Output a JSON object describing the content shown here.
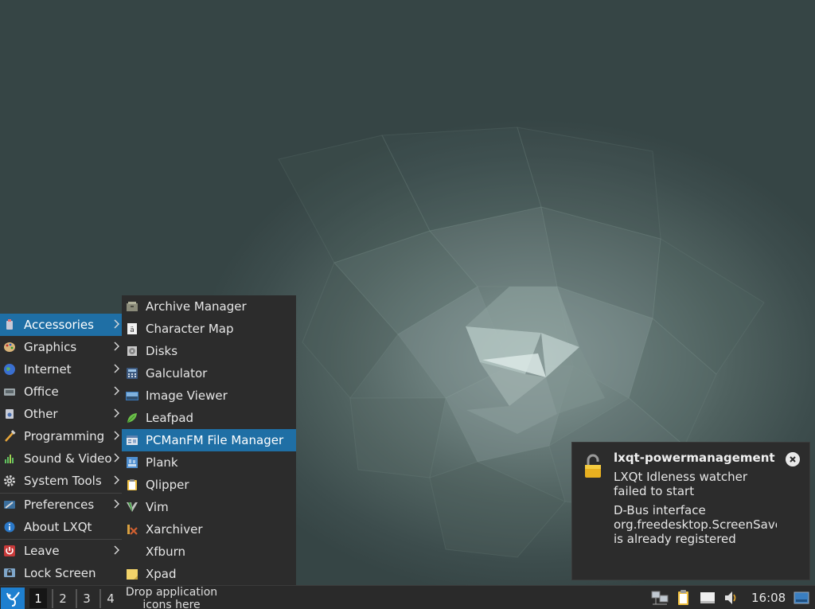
{
  "main_menu": {
    "items": [
      {
        "label": "Accessories",
        "icon": "accessories-icon"
      },
      {
        "label": "Graphics",
        "icon": "graphics-icon"
      },
      {
        "label": "Internet",
        "icon": "internet-icon"
      },
      {
        "label": "Office",
        "icon": "office-icon"
      },
      {
        "label": "Other",
        "icon": "other-icon"
      },
      {
        "label": "Programming",
        "icon": "programming-icon"
      },
      {
        "label": "Sound & Video",
        "icon": "sound-video-icon"
      },
      {
        "label": "System Tools",
        "icon": "system-tools-icon"
      },
      {
        "label": "Preferences",
        "icon": "preferences-icon"
      },
      {
        "label": "About LXQt",
        "icon": "about-icon"
      },
      {
        "label": "Leave",
        "icon": "leave-icon"
      },
      {
        "label": "Lock Screen",
        "icon": "lock-screen-icon"
      }
    ]
  },
  "sub_menu": {
    "items": [
      {
        "label": "Archive Manager",
        "icon": "archive-manager-icon"
      },
      {
        "label": "Character Map",
        "icon": "character-map-icon"
      },
      {
        "label": "Disks",
        "icon": "disks-icon"
      },
      {
        "label": "Galculator",
        "icon": "calculator-icon"
      },
      {
        "label": "Image Viewer",
        "icon": "image-viewer-icon"
      },
      {
        "label": "Leafpad",
        "icon": "leafpad-icon"
      },
      {
        "label": "PCManFM File Manager",
        "icon": "file-manager-icon"
      },
      {
        "label": "Plank",
        "icon": "plank-icon"
      },
      {
        "label": "Qlipper",
        "icon": "clipboard-icon"
      },
      {
        "label": "Vim",
        "icon": "vim-icon"
      },
      {
        "label": "Xarchiver",
        "icon": "xarchiver-icon"
      },
      {
        "label": "Xfburn",
        "icon": ""
      },
      {
        "label": "Xpad",
        "icon": "xpad-icon"
      }
    ]
  },
  "taskbar": {
    "workspaces": [
      "1",
      "2",
      "3",
      "4"
    ],
    "quicklaunch_text": "Drop application\nicons here",
    "clock": "16:08"
  },
  "notification": {
    "title": "lxqt-powermanagement",
    "line1": "LXQt Idleness watcher\nfailed to start",
    "line2": "D-Bus interface\norg.freedesktop.ScreenSaver\nis already registered"
  },
  "colors": {
    "accent": "#1f6fa5",
    "menu_bg": "#2c2c2c",
    "taskbar_bg": "#2a2a2a"
  }
}
